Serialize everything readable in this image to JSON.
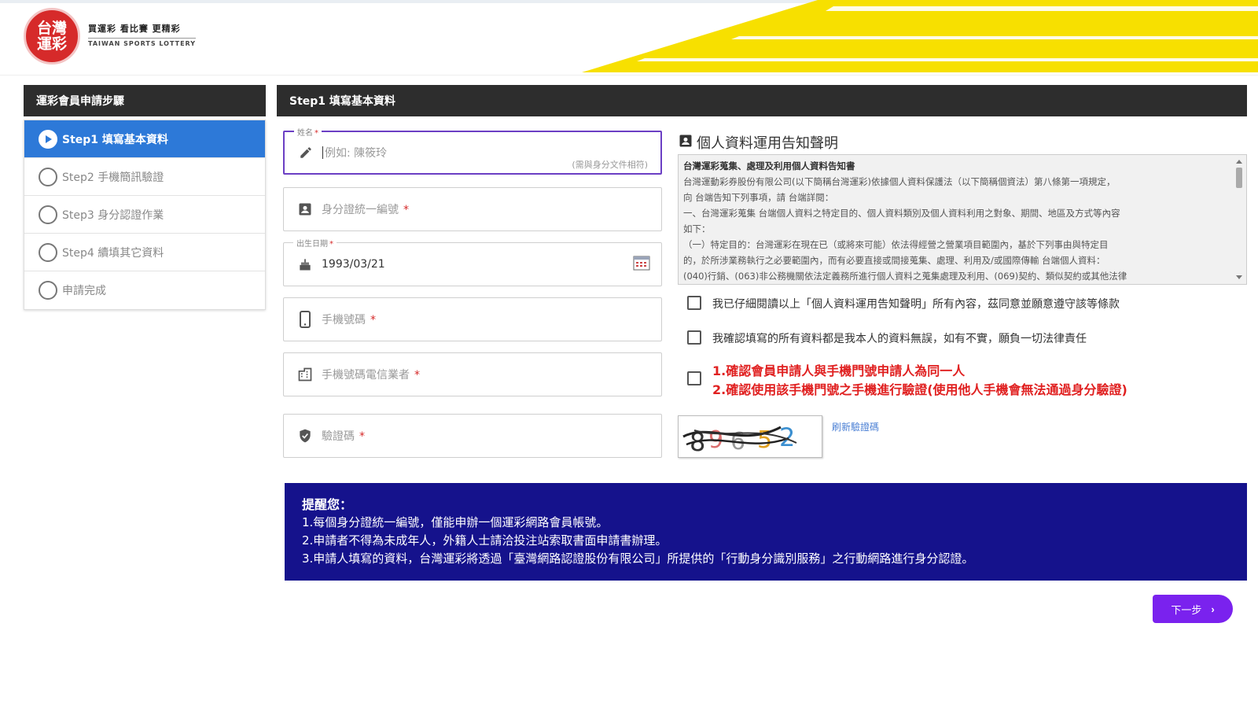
{
  "header": {
    "logo_text_line1": "台灣",
    "logo_text_line2": "運彩",
    "slogan": "買運彩 看比賽 更精彩",
    "subtitle": "TAIWAN SPORTS LOTTERY",
    "accent_color": "#f7e000",
    "logo_color": "#d62a2a"
  },
  "steps": {
    "title": "運彩會員申請步驟",
    "items": [
      {
        "label": "Step1 填寫基本資料",
        "active": true
      },
      {
        "label": "Step2 手機簡訊驗證",
        "active": false
      },
      {
        "label": "Step3 身分認證作業",
        "active": false
      },
      {
        "label": "Step4 續填其它資料",
        "active": false
      },
      {
        "label": "申請完成",
        "active": false
      }
    ],
    "active_color": "#2d79d8"
  },
  "main": {
    "title": "Step1 填寫基本資料"
  },
  "form": {
    "name": {
      "label": "姓名",
      "placeholder": "例如: 陳筱玲",
      "hint": "(需與身分文件相符)",
      "required": "*"
    },
    "id_number": {
      "label": "身分證統一編號",
      "required": "*"
    },
    "birthday": {
      "label": "出生日期",
      "value": "1993/03/21",
      "required": "*"
    },
    "mobile": {
      "label": "手機號碼",
      "required": "*"
    },
    "carrier": {
      "label": "手機號碼電信業者",
      "required": "*"
    },
    "captcha": {
      "label": "驗證碼",
      "required": "*"
    }
  },
  "privacy": {
    "title": "個人資料運用告知聲明",
    "lines": [
      "台灣運彩蒐集、處理及利用個人資料告知書",
      "台灣運動彩券股份有限公司(以下簡稱台灣運彩)依據個人資料保護法（以下簡稱個資法）第八條第一項規定，",
      "向 台端告知下列事項，請 台端詳閱：",
      "一、台灣運彩蒐集 台端個人資料之特定目的、個人資料類別及個人資料利用之對象、期間、地區及方式等內容",
      "如下：",
      "（一）特定目的：台灣運彩在現在已（或將來可能）依法得經營之營業項目範圍內，基於下列事由與特定目",
      "的，於所涉業務執行之必要範圍內，而有必要直接或間接蒐集、處理、利用及/或國際傳輸 台端個人資料：",
      "(040)行銷、(063)非公務機關依法定義務所進行個人資料之蒐集處理及利用、(069)契約、類似契約或其他法律"
    ],
    "checkbox1": "我已仔細閱讀以上「個人資料運用告知聲明」所有內容，茲同意並願意遵守該等條款",
    "checkbox2": "我確認填寫的所有資料都是我本人的資料無誤，如有不實，願負一切法律責任",
    "checkbox3_line1": "1.確認會員申請人與手機門號申請人為同一人",
    "checkbox3_line2": "2.確認使用該手機門號之手機進行驗證(使用他人手機會無法通過身分驗證)"
  },
  "captcha": {
    "image_text": "8 9 6 5 2",
    "refresh_label": "刷新驗證碼"
  },
  "notice": {
    "title": "提醒您：",
    "lines": [
      "1.每個身分證統一編號，僅能申辦一個運彩網路會員帳號。",
      "2.申請者不得為未成年人，外籍人士請洽投注站索取書面申請書辦理。",
      "3.申請人填寫的資料，台灣運彩將透過「臺灣網路認證股份有限公司」所提供的「行動身分識別服務」之行動網路進行身分認證。"
    ],
    "bg_color": "#15128c"
  },
  "next_button": {
    "label": "下一步",
    "arrow": "›",
    "color": "#7a22ee"
  }
}
